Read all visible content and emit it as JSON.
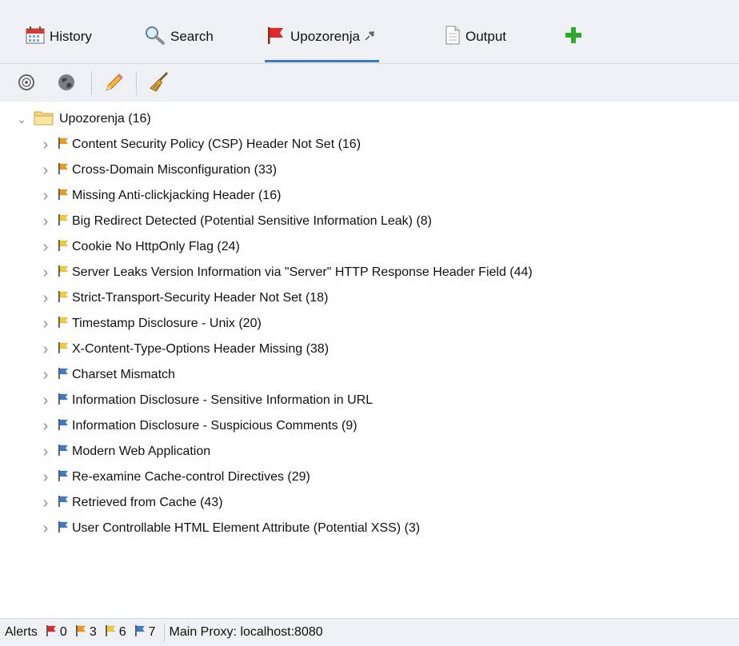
{
  "tabs": [
    {
      "label": "History",
      "icon": "calendar-icon"
    },
    {
      "label": "Search",
      "icon": "magnifier-icon"
    },
    {
      "label": "Upozorenja",
      "icon": "red-flag-icon",
      "active": true,
      "pinned": true
    },
    {
      "label": "Output",
      "icon": "document-icon"
    }
  ],
  "tree": {
    "root_label": "Upozorenja (16)",
    "items": [
      {
        "label": "Content Security Policy (CSP) Header Not Set (16)",
        "risk": "medium"
      },
      {
        "label": "Cross-Domain Misconfiguration (33)",
        "risk": "medium"
      },
      {
        "label": "Missing Anti-clickjacking Header (16)",
        "risk": "medium"
      },
      {
        "label": "Big Redirect Detected (Potential Sensitive Information Leak) (8)",
        "risk": "low"
      },
      {
        "label": "Cookie No HttpOnly Flag (24)",
        "risk": "low"
      },
      {
        "label": "Server Leaks Version Information via \"Server\" HTTP Response Header Field (44)",
        "risk": "low"
      },
      {
        "label": "Strict-Transport-Security Header Not Set (18)",
        "risk": "low"
      },
      {
        "label": "Timestamp Disclosure - Unix (20)",
        "risk": "low"
      },
      {
        "label": "X-Content-Type-Options Header Missing (38)",
        "risk": "low"
      },
      {
        "label": "Charset Mismatch",
        "risk": "info"
      },
      {
        "label": "Information Disclosure - Sensitive Information in URL",
        "risk": "info"
      },
      {
        "label": "Information Disclosure - Suspicious Comments (9)",
        "risk": "info"
      },
      {
        "label": "Modern Web Application",
        "risk": "info"
      },
      {
        "label": "Re-examine Cache-control Directives (29)",
        "risk": "info"
      },
      {
        "label": "Retrieved from Cache (43)",
        "risk": "info"
      },
      {
        "label": "User Controllable HTML Element Attribute (Potential XSS) (3)",
        "risk": "info"
      }
    ]
  },
  "status": {
    "alerts_label": "Alerts",
    "high_count": "0",
    "medium_count": "3",
    "low_count": "6",
    "info_count": "7",
    "proxy_label": "Main Proxy: localhost:8080"
  },
  "colors": {
    "high": "#e0282b",
    "medium": "#f29a1c",
    "low": "#f5cc33",
    "info": "#3b7dd0",
    "accent": "#3b78c2"
  }
}
